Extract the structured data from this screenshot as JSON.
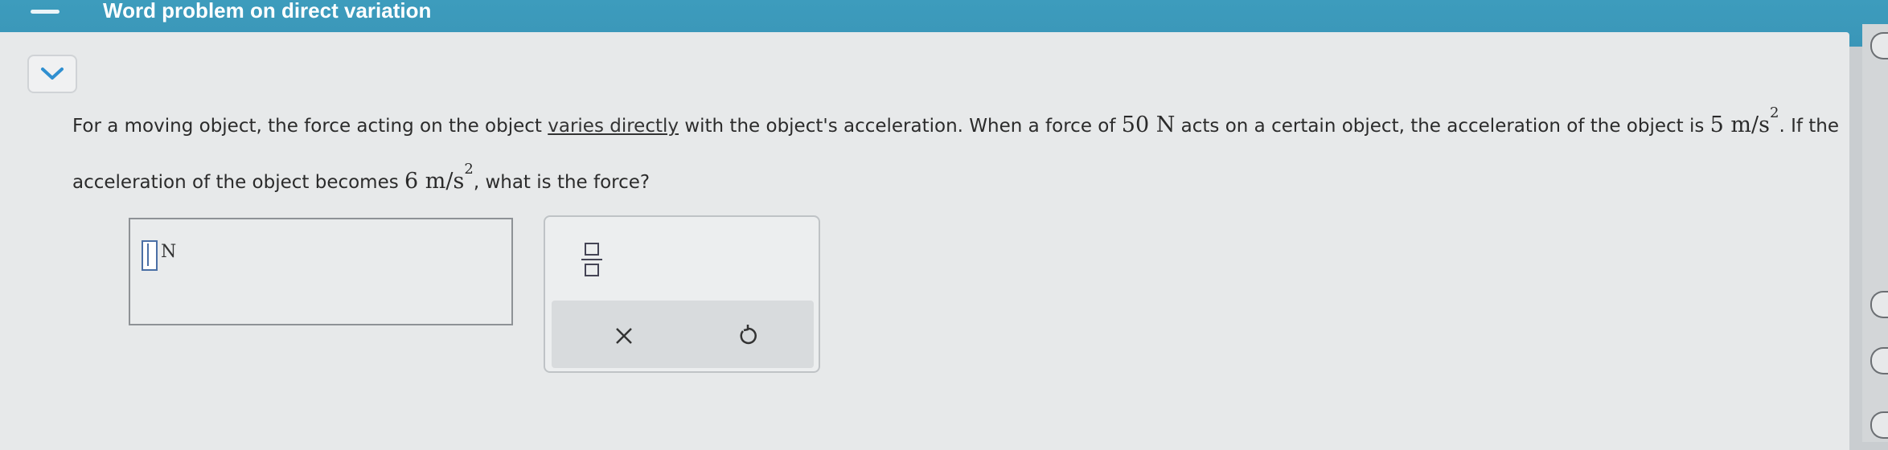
{
  "header": {
    "title": "Word problem on direct variation"
  },
  "question": {
    "part1": "For a moving object, the force acting on the object ",
    "link": "varies directly",
    "part2": " with the object's acceleration. When a force of ",
    "force_value": "50 N",
    "part3": " acts on a certain object, the acceleration of the object is ",
    "accel1": "5 m/s",
    "accel1_exp": "2",
    "part4": ". If the acceleration of the object becomes ",
    "accel2": "6 m/s",
    "accel2_exp": "2",
    "part5": ", what is the force?"
  },
  "answer": {
    "unit": "N"
  },
  "toolbox": {
    "clear_symbol": "×"
  },
  "icons": {
    "menu": "hamburger-icon",
    "collapse": "chevron-down-icon",
    "fraction": "fraction-icon",
    "clear": "x-icon",
    "undo": "undo-icon"
  },
  "colors": {
    "header_bg": "#3d9cbd",
    "chevron": "#2f8fd0"
  }
}
